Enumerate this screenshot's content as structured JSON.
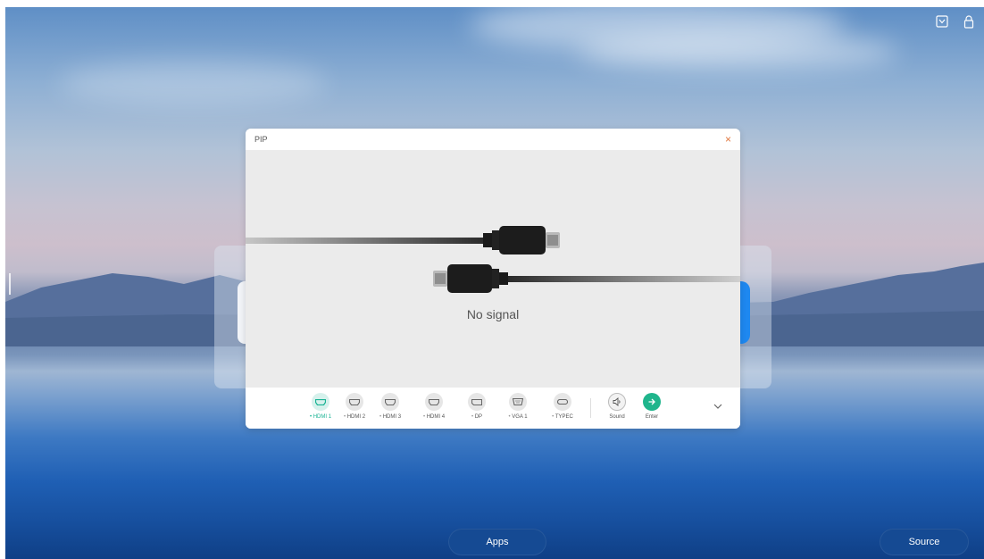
{
  "pip": {
    "title": "PIP",
    "close_label": "×",
    "message": "No signal"
  },
  "sources": [
    {
      "label": "HDMI 1",
      "icon": "hdmi-icon",
      "active": true
    },
    {
      "label": "HDMI 2",
      "icon": "hdmi-icon",
      "active": false
    },
    {
      "label": "HDMI 3",
      "icon": "hdmi-icon",
      "active": false
    },
    {
      "label": "HDMI 4",
      "icon": "hdmi-icon",
      "active": false
    },
    {
      "label": "DP",
      "icon": "displayport-icon",
      "active": false
    },
    {
      "label": "VGA 1",
      "icon": "vga-icon",
      "active": false
    },
    {
      "label": "TYPEC",
      "icon": "usb-c-icon",
      "active": false
    }
  ],
  "actions": {
    "sound_label": "Sound",
    "enter_label": "Enter"
  },
  "dock": {
    "apps_label": "Apps",
    "source_label": "Source"
  },
  "top_icons": [
    "screen-cast-icon",
    "lock-icon"
  ],
  "colors": {
    "accent": "#19b394",
    "close": "#e07840",
    "pill": "#154a93"
  }
}
